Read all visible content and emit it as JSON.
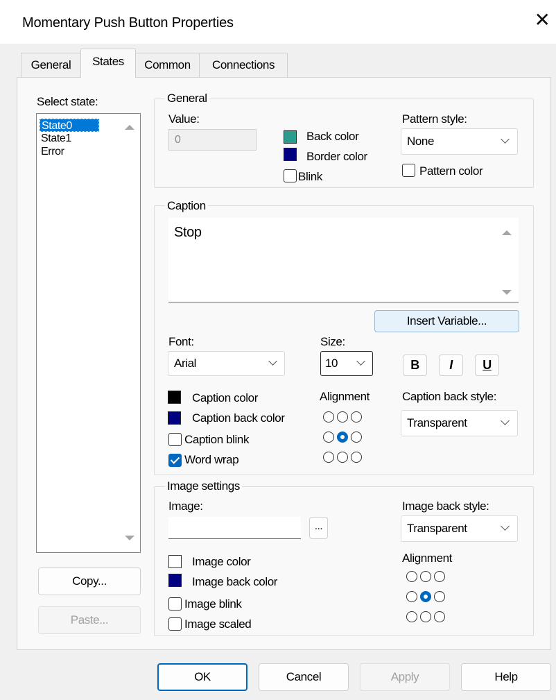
{
  "window": {
    "title": "Momentary Push Button Properties"
  },
  "tabs": [
    {
      "label": "General"
    },
    {
      "label": "States"
    },
    {
      "label": "Common"
    },
    {
      "label": "Connections"
    }
  ],
  "select_state": {
    "label": "Select state:",
    "items": [
      "State0",
      "State1",
      "Error"
    ],
    "selected": "State0",
    "copy_label": "Copy...",
    "paste_label": "Paste..."
  },
  "general": {
    "legend": "General",
    "value_label": "Value:",
    "value": "0",
    "back_color_label": "Back color",
    "back_color": "#2a9d8f",
    "border_color_label": "Border color",
    "border_color": "#000080",
    "blink_label": "Blink",
    "pattern_style_label": "Pattern style:",
    "pattern_style": "None",
    "pattern_color_label": "Pattern color"
  },
  "caption": {
    "legend": "Caption",
    "text": "Stop",
    "insert_variable_label": "Insert Variable...",
    "font_label": "Font:",
    "font_value": "Arial",
    "size_label": "Size:",
    "size_value": "10",
    "bold": "B",
    "italic": "I",
    "underline": "U",
    "caption_color_label": "Caption color",
    "caption_color": "#000000",
    "caption_back_color_label": "Caption back color",
    "caption_back_color": "#000080",
    "caption_blink_label": "Caption blink",
    "word_wrap_label": "Word wrap",
    "word_wrap": true,
    "alignment_label": "Alignment",
    "back_style_label": "Caption back style:",
    "back_style": "Transparent"
  },
  "image_settings": {
    "legend": "Image settings",
    "image_label": "Image:",
    "image_value": "",
    "browse_label": "...",
    "back_style_label": "Image back style:",
    "back_style": "Transparent",
    "image_color_label": "Image color",
    "image_back_color_label": "Image back color",
    "image_back_color": "#000080",
    "image_blink_label": "Image blink",
    "image_scaled_label": "Image scaled",
    "alignment_label": "Alignment"
  },
  "footer": {
    "ok": "OK",
    "cancel": "Cancel",
    "apply": "Apply",
    "help": "Help"
  }
}
